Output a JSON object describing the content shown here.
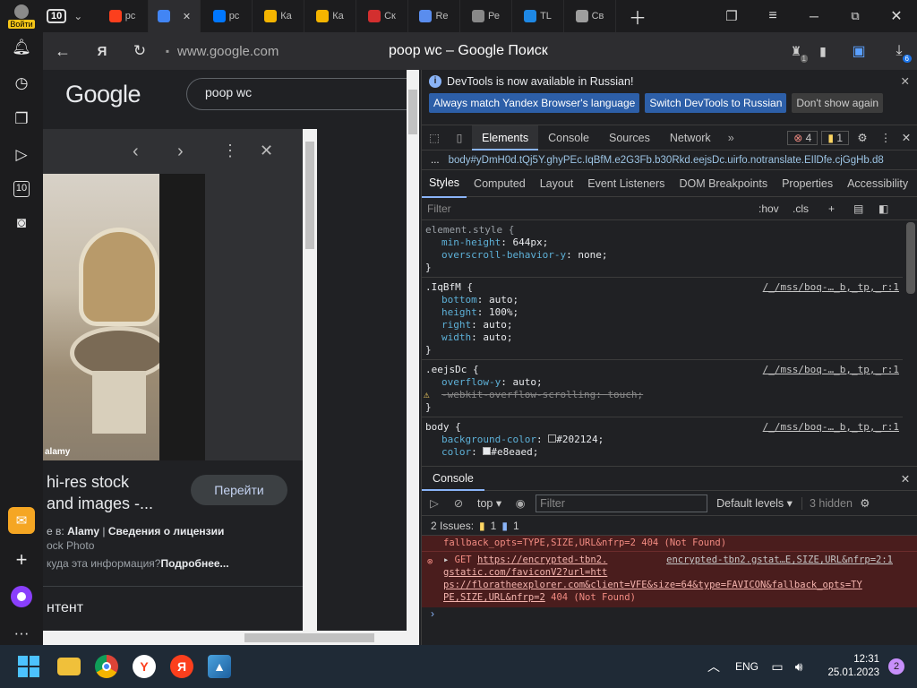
{
  "tabstrip": {
    "profile_label": "Войти",
    "tab_counter": "10",
    "tabs": [
      {
        "icon": "yandex-icon",
        "label": "рс",
        "color": "#fc3f1d"
      },
      {
        "icon": "google-icon",
        "label": "",
        "color": "#4285f4"
      },
      {
        "icon": "vk-icon",
        "label": "рс",
        "color": "#0077ff"
      },
      {
        "icon": "image-icon",
        "label": "Ка",
        "color": "#f4b400"
      },
      {
        "icon": "image-icon",
        "label": "Ка",
        "color": "#f4b400"
      },
      {
        "icon": "car-icon",
        "label": "Ск",
        "color": "#d32f2f"
      },
      {
        "icon": "cursor-icon",
        "label": "Re",
        "color": "#5a8dee"
      },
      {
        "icon": "phone-icon",
        "label": "Ре",
        "color": "#888888"
      },
      {
        "icon": "tl-icon",
        "label": "TL",
        "color": "#1e88e5"
      },
      {
        "icon": "box-icon",
        "label": "Св",
        "color": "#9e9e9e"
      }
    ]
  },
  "addressbar": {
    "url": "www.google.com",
    "page_title": "poop wc – Google Поиск",
    "downloads_badge": "6",
    "ext_badge": "1"
  },
  "page": {
    "google_logo": "Google",
    "search_query": "poop wc",
    "result_title_1": "hi-res stock",
    "result_title_2": "and images -...",
    "source_prefix": "е в:",
    "source_name": "Alamy",
    "license_link": "Сведения о лицензии",
    "source_sub": "ock Photo",
    "info_text": "куда эта информация?",
    "more_link": "Подробнее...",
    "goto_button": "Перейти",
    "bottom_text": "нтент",
    "image_watermark": "alamy"
  },
  "devtools": {
    "banner_text": "DevTools is now available in Russian!",
    "banner_btn1": "Always match Yandex Browser's language",
    "banner_btn2": "Switch DevTools to Russian",
    "banner_btn3": "Don't show again",
    "tabs": [
      "Elements",
      "Console",
      "Sources",
      "Network"
    ],
    "errors_count": "4",
    "warnings_count": "1",
    "breadcrumb": "body#yDmH0d.tQj5Y.ghyPEc.IqBfM.e2G3Fb.b30Rkd.eejsDc.uirfo.notranslate.EIlDfe.cjGgHb.d8",
    "breadcrumb_prefix": "...",
    "subtabs": [
      "Styles",
      "Computed",
      "Layout",
      "Event Listeners",
      "DOM Breakpoints",
      "Properties",
      "Accessibility"
    ],
    "filter_placeholder": "Filter",
    "hov": ":hov",
    "cls": ".cls",
    "rules": [
      {
        "selector": "element.style {",
        "source": "",
        "props": [
          [
            "min-height",
            "644px;"
          ],
          [
            "overscroll-behavior-y",
            "none;"
          ]
        ]
      },
      {
        "selector": ".IqBfM {",
        "source": "/_/mss/boq-…_b,_tp,_r:1",
        "props": [
          [
            "bottom",
            "auto;"
          ],
          [
            "height",
            "100%;"
          ],
          [
            "right",
            "auto;"
          ],
          [
            "width",
            "auto;"
          ]
        ]
      },
      {
        "selector": ".eejsDc {",
        "source": "/_/mss/boq-…_b,_tp,_r:1",
        "props": [
          [
            "overflow-y",
            "auto;"
          ],
          [
            "-webkit-overflow-scrolling",
            "touch;"
          ]
        ]
      },
      {
        "selector": "body {",
        "source": "/_/mss/boq-…_b,_tp,_r:1",
        "props": [
          [
            "background-color",
            "#202124;"
          ],
          [
            "color",
            "#e8eaed;"
          ]
        ]
      }
    ],
    "closing_brace": "}",
    "console_tab": "Console",
    "console_context": "top",
    "console_filter_placeholder": "Filter",
    "default_levels": "Default levels",
    "hidden_count": "3 hidden",
    "issues_label": "2 Issues:",
    "issues_warn": "1",
    "issues_info": "1",
    "log_line0": "fallback_opts=TYPE,SIZE,URL&nfrp=2 404 (Not Found)",
    "log_get": "GET",
    "log_url1": "https://encrypted-tbn2.",
    "log_src": "encrypted-tbn2.gstat…E,SIZE,URL&nfrp=2:1",
    "log_url2": "gstatic.com/faviconV2?url=htt",
    "log_url3": "ps://floratheexplorer.com&client=VFE&size=64&type=FAVICON&fallback_opts=TY",
    "log_url4": "PE,SIZE,URL&nfrp=2",
    "log_status": "404 (Not Found)"
  },
  "taskbar": {
    "lang": "ENG",
    "time": "12:31",
    "date": "25.01.2023",
    "notif_count": "2"
  }
}
